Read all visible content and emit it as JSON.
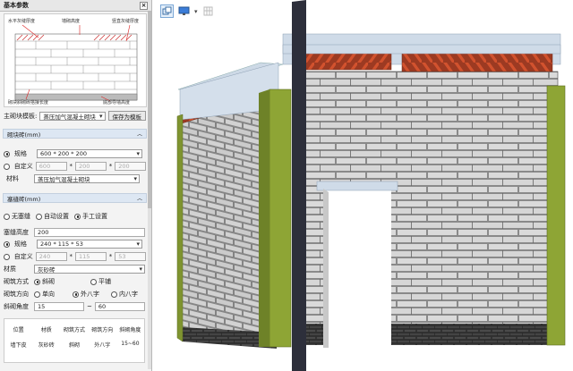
{
  "panel": {
    "title": "基本参数",
    "close": "×",
    "illustration": {
      "labels": {
        "horizontal_joint": "水平灰缝厚度",
        "masonry_height": "墙砌高度",
        "vertical_joint": "竖直灰缝厚度",
        "slant_brick_length": "砌块斜砌砖搭接长度",
        "bottom_height": "底部导墙高度"
      }
    },
    "template": {
      "label": "主砌块模板:",
      "value": "蒸压加气混凝土砌块",
      "button": "保存为模板"
    },
    "block_section": {
      "title": "砌块砖(mm)",
      "spec_label": "规格",
      "spec_value": "600 * 200 * 200",
      "custom_label": "自定义",
      "custom_values": [
        "600",
        "200",
        "200"
      ],
      "material_label": "材料",
      "material_value": "蒸压加气混凝土砌块"
    },
    "slant_section": {
      "title": "塞缝砖(mm)",
      "modes": [
        "无塞缝",
        "自动设置",
        "手工设置"
      ],
      "height_label": "塞缝高度",
      "height_value": "200",
      "spec_label": "规格",
      "spec_value": "240 * 115 * 53",
      "custom_label": "自定义",
      "custom_values": [
        "240",
        "115",
        "53"
      ],
      "material_label": "材质",
      "material_value": "灰砂砖",
      "method_label": "砌筑方式",
      "method_options": [
        "斜砌",
        "平铺"
      ],
      "dir_label": "砌筑方向",
      "dir_options": [
        "单向",
        "外八字",
        "内八字"
      ],
      "angle_label": "斜砌角度",
      "angle_min": "15",
      "angle_max": "60"
    },
    "table": {
      "headers": [
        "位置",
        "材质",
        "砌筑方式",
        "砌筑方向",
        "斜砌角度"
      ],
      "rows": [
        [
          "墙下皮",
          "灰砂砖",
          "斜砌",
          "外八字",
          "15~60"
        ]
      ]
    }
  },
  "toolbar": {
    "icons": [
      "copy-view-icon",
      "display-icon",
      "dropdown-icon",
      "grid-icon"
    ]
  },
  "colors": {
    "accent": "#4a7fb5",
    "wall": "#dcdcdc",
    "column": "#8ea535",
    "slant_brick": "#c8452a",
    "beam": "#cfdbe8",
    "base": "#3a3a3a"
  }
}
